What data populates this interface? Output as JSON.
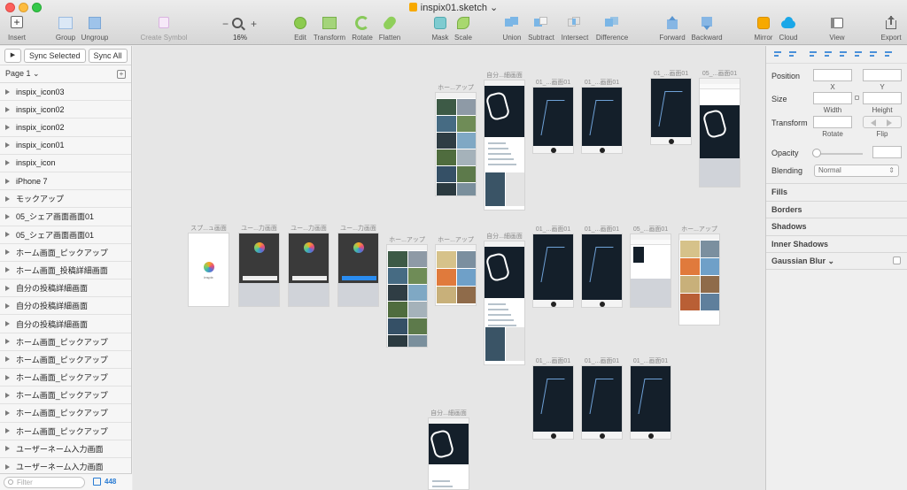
{
  "window": {
    "title": "inspix01.sketch"
  },
  "toolbar": {
    "insert": "Insert",
    "group": "Group",
    "ungroup": "Ungroup",
    "create_symbol": "Create Symbol",
    "zoom_minus": "−",
    "zoom_plus": "+",
    "zoom_value": "16%",
    "edit": "Edit",
    "transform": "Transform",
    "rotate": "Rotate",
    "flatten": "Flatten",
    "mask": "Mask",
    "scale": "Scale",
    "union": "Union",
    "subtract": "Subtract",
    "intersect": "Intersect",
    "difference": "Difference",
    "forward": "Forward",
    "backward": "Backward",
    "mirror": "Mirror",
    "cloud": "Cloud",
    "view": "View",
    "export": "Export"
  },
  "sidebar": {
    "play": "▶",
    "sync_selected": "Sync Selected",
    "sync_all": "Sync All",
    "page": "Page 1 ⌄",
    "layers": [
      "inspix_icon03",
      "inspix_icon02",
      "inspix_icon02",
      "inspix_icon01",
      "inspix_icon",
      "iPhone 7",
      "モックアップ",
      "05_シェア画面画面01",
      "05_シェア画面画面01",
      "ホーム画面_ピックアップ",
      "ホーム画面_投稿詳細画面",
      "自分の投稿詳細画面",
      "自分の投稿詳細画面",
      "自分の投稿詳細画面",
      "ホーム画面_ピックアップ",
      "ホーム画面_ピックアップ",
      "ホーム画面_ピックアップ",
      "ホーム画面_ピックアップ",
      "ホーム画面_ピックアップ",
      "ホーム画面_ピックアップ",
      "ユーザーネーム入力画面",
      "ユーザーネーム入力画面"
    ],
    "filter_placeholder": "Filter",
    "count": "448"
  },
  "canvas": {
    "artboards": [
      "ホー...アップ",
      "自分...細画面",
      "01_...画面01",
      "01_...画面01",
      "01_...画面01",
      "05_...画面01",
      "スプ...ュ画面",
      "ユー...力画面",
      "ユー...力画面",
      "ユー...力画面",
      "ホー...アップ",
      "ホー...アップ",
      "自分...細画面",
      "01_...画面01",
      "01_...画面01",
      "05_...画面01",
      "ホー...アップ",
      "01_...画面01",
      "01_...画面01",
      "01_...画面01",
      "自分...細画面"
    ],
    "app_name": "inspix"
  },
  "inspector": {
    "position": "Position",
    "x_label": "X",
    "y_label": "Y",
    "size": "Size",
    "width_label": "Width",
    "height_label": "Height",
    "transform": "Transform",
    "rotate_label": "Rotate",
    "flip_label": "Flip",
    "opacity": "Opacity",
    "blending": "Blending",
    "blending_value": "Normal",
    "fills": "Fills",
    "borders": "Borders",
    "shadows": "Shadows",
    "inner_shadows": "Inner Shadows",
    "gaussian_blur": "Gaussian Blur ⌄"
  },
  "colors": {
    "accent": "#2a7cd3",
    "artboard_dark": "#141f2a",
    "keyboard": "#d0d3d9"
  }
}
